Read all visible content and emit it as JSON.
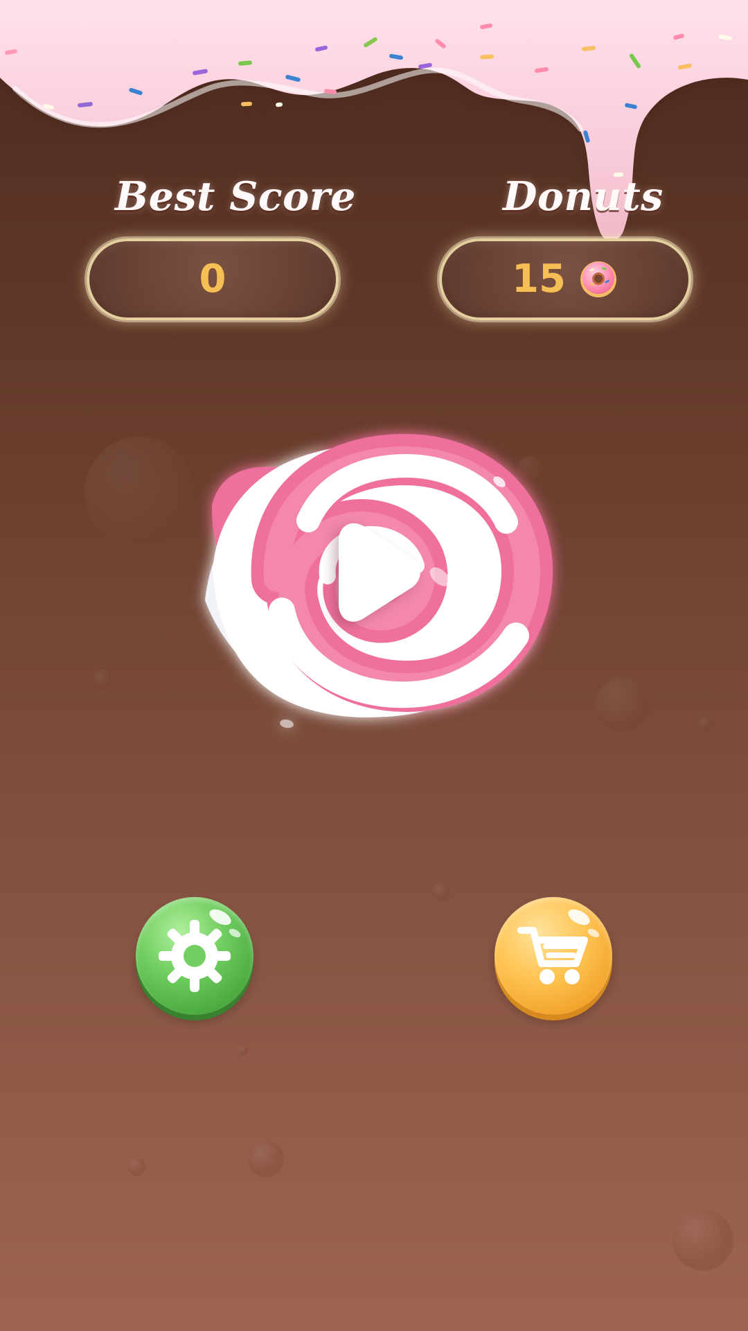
{
  "hud": {
    "best_score_label": "Best Score",
    "best_score_value": "0",
    "donuts_label": "Donuts",
    "donuts_value": "15"
  },
  "icons": {
    "currency": "donut-icon",
    "play": "play-icon",
    "settings": "gear-icon",
    "shop": "cart-icon"
  },
  "colors": {
    "background_top": "#4c2a1e",
    "background_bottom": "#9e6452",
    "icing_pink": "#f8c9d7",
    "score_gold": "#f5bf55",
    "settings_green": "#62c252",
    "shop_orange": "#f3ae36"
  }
}
